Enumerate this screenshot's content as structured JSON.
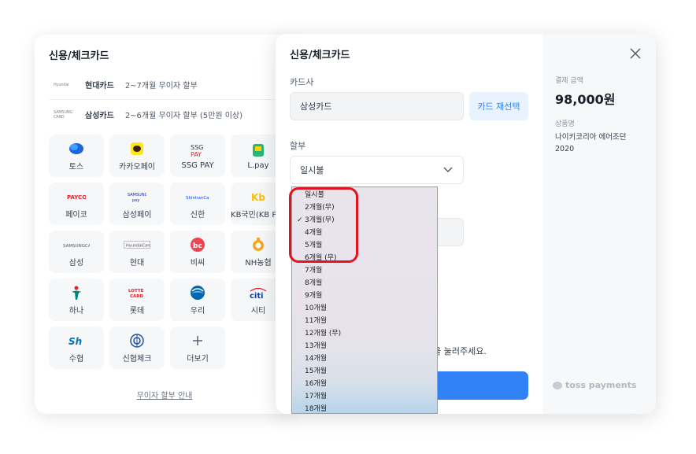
{
  "background_panel": {
    "title": "신용/체크카드",
    "promotions": [
      {
        "logo": "Hyundai",
        "name": "현대카드",
        "text": "2~7개월 무이자 할부"
      },
      {
        "logo": "SAMSUNG CARD",
        "name": "삼성카드",
        "text": "2~6개월 무이자 할부 (5만원 이상)"
      }
    ],
    "cards": [
      {
        "label": "토스",
        "icon": "toss-icon"
      },
      {
        "label": "카카오페이",
        "icon": "kakaopay-icon"
      },
      {
        "label": "SSG PAY",
        "icon": "ssgpay-icon"
      },
      {
        "label": "L.pay",
        "icon": "lpay-icon"
      },
      {
        "label": "페이코",
        "icon": "payco-icon"
      },
      {
        "label": "삼성페이",
        "icon": "samsungpay-icon"
      },
      {
        "label": "신한",
        "icon": "shinhan-icon"
      },
      {
        "label": "KB국민(KB Pay",
        "icon": "kb-icon"
      },
      {
        "label": "삼성",
        "icon": "samsungcard-icon"
      },
      {
        "label": "현대",
        "icon": "hyundaicard-icon"
      },
      {
        "label": "비씨",
        "icon": "bc-icon"
      },
      {
        "label": "NH농협",
        "icon": "nh-icon"
      },
      {
        "label": "하나",
        "icon": "hana-icon"
      },
      {
        "label": "롯데",
        "icon": "lotte-icon"
      },
      {
        "label": "우리",
        "icon": "woori-icon"
      },
      {
        "label": "시티",
        "icon": "citi-icon"
      },
      {
        "label": "수협",
        "icon": "sh-icon"
      },
      {
        "label": "신협체크",
        "icon": "cu-icon"
      },
      {
        "label": "더보기",
        "icon": "plus-icon"
      }
    ],
    "footer_link": "무이자 할부 안내"
  },
  "modal": {
    "title": "신용/체크카드",
    "card_company_label": "카드사",
    "card_company_value": "삼성카드",
    "reselect_button": "카드 재선택",
    "installment_label": "할부",
    "installment_value": "일시불",
    "notice_text": "튼을 눌러주세요.",
    "summary": {
      "amount_label": "결제 금액",
      "amount_value": "98,000원",
      "product_label": "상품명",
      "product_value": "나이키코리아 에어조던 2020"
    },
    "brand": "toss payments"
  },
  "dropdown": {
    "selected": "3개월(무)",
    "options": [
      "일시불",
      "2개월(무)",
      "3개월(무)",
      "4개월",
      "5개월",
      "6개월 (무)",
      "7개월",
      "8개월",
      "9개월",
      "10개월",
      "11개월",
      "12개월 (무)",
      "13개월",
      "14개월",
      "15개월",
      "16개월",
      "17개월",
      "18개월"
    ]
  },
  "colors": {
    "accent": "#3182f6",
    "accent_light": "#e8f3ff",
    "highlight": "#e3131d"
  }
}
